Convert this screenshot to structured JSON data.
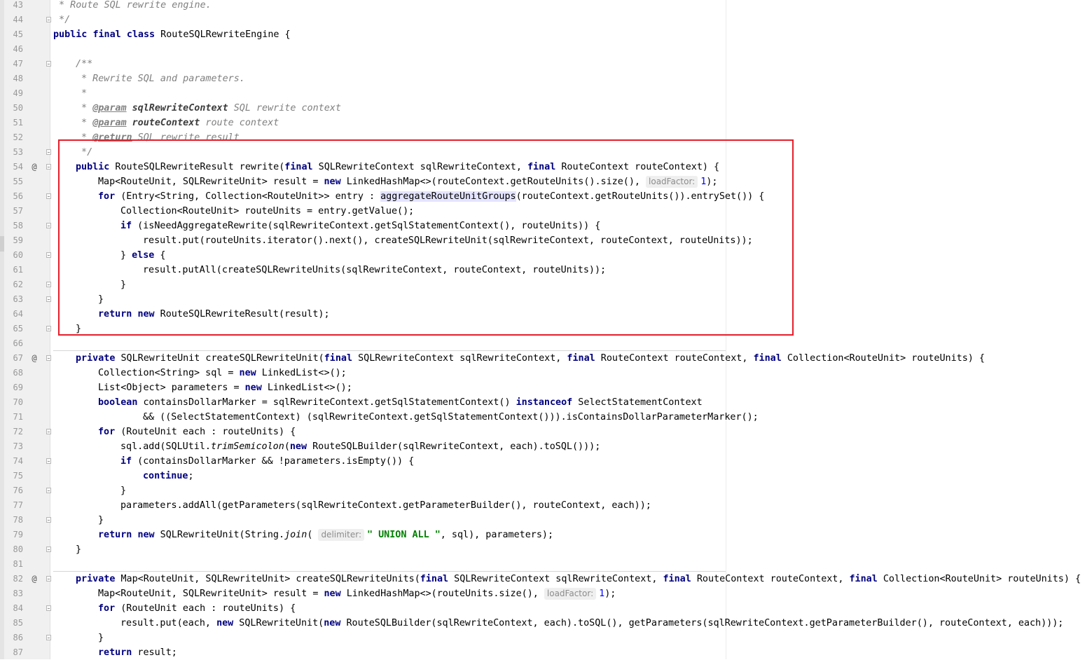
{
  "editor": {
    "lines": [
      {
        "num": "43",
        "marker": "",
        "fold": false,
        "indent": 0,
        "tokens": [
          {
            "t": " * Route SQL rewrite engine.",
            "c": "cm"
          }
        ]
      },
      {
        "num": "44",
        "marker": "",
        "fold": true,
        "indent": 0,
        "tokens": [
          {
            "t": " */",
            "c": "cm"
          }
        ]
      },
      {
        "num": "45",
        "marker": "",
        "fold": false,
        "indent": 0,
        "tokens": [
          {
            "t": "public",
            "c": "kw"
          },
          {
            "t": " "
          },
          {
            "t": "final",
            "c": "kw"
          },
          {
            "t": " "
          },
          {
            "t": "class",
            "c": "kw"
          },
          {
            "t": " RouteSQLRewriteEngine {"
          }
        ]
      },
      {
        "num": "46",
        "marker": "",
        "fold": false,
        "indent": 0,
        "tokens": []
      },
      {
        "num": "47",
        "marker": "",
        "fold": true,
        "indent": 1,
        "tokens": [
          {
            "t": "/**",
            "c": "cm"
          }
        ]
      },
      {
        "num": "48",
        "marker": "",
        "fold": false,
        "indent": 1,
        "tokens": [
          {
            "t": " * Rewrite SQL and parameters.",
            "c": "cm"
          }
        ]
      },
      {
        "num": "49",
        "marker": "",
        "fold": false,
        "indent": 1,
        "tokens": [
          {
            "t": " *",
            "c": "cm"
          }
        ]
      },
      {
        "num": "50",
        "marker": "",
        "fold": false,
        "indent": 1,
        "tokens": [
          {
            "t": " * ",
            "c": "cm"
          },
          {
            "t": "@param",
            "c": "tag"
          },
          {
            "t": " "
          },
          {
            "t": "sqlRewriteContext",
            "c": "tagp"
          },
          {
            "t": " SQL rewrite context",
            "c": "cm"
          }
        ]
      },
      {
        "num": "51",
        "marker": "",
        "fold": false,
        "indent": 1,
        "tokens": [
          {
            "t": " * ",
            "c": "cm"
          },
          {
            "t": "@param",
            "c": "tag"
          },
          {
            "t": " "
          },
          {
            "t": "routeContext",
            "c": "tagp"
          },
          {
            "t": " route context",
            "c": "cm"
          }
        ]
      },
      {
        "num": "52",
        "marker": "",
        "fold": false,
        "indent": 1,
        "tokens": [
          {
            "t": " * ",
            "c": "cm"
          },
          {
            "t": "@return",
            "c": "tag"
          },
          {
            "t": " SQL rewrite result",
            "c": "cm"
          }
        ]
      },
      {
        "num": "53",
        "marker": "",
        "fold": true,
        "indent": 1,
        "tokens": [
          {
            "t": " */",
            "c": "cm"
          }
        ]
      },
      {
        "num": "54",
        "marker": "@",
        "fold": true,
        "indent": 1,
        "tokens": [
          {
            "t": "public",
            "c": "kw"
          },
          {
            "t": " RouteSQLRewriteResult rewrite("
          },
          {
            "t": "final",
            "c": "kw"
          },
          {
            "t": " SQLRewriteContext sqlRewriteContext, "
          },
          {
            "t": "final",
            "c": "kw"
          },
          {
            "t": " RouteContext routeContext) {"
          }
        ]
      },
      {
        "num": "55",
        "marker": "",
        "fold": false,
        "indent": 2,
        "tokens": [
          {
            "t": "Map<RouteUnit, SQLRewriteUnit> result = "
          },
          {
            "t": "new",
            "c": "kw"
          },
          {
            "t": " LinkedHashMap<>(routeContext.getRouteUnits().size(), "
          },
          {
            "t": "loadFactor:",
            "c": "hint"
          },
          {
            "t": "1",
            "c": "num"
          },
          {
            "t": ");"
          }
        ]
      },
      {
        "num": "56",
        "marker": "",
        "fold": true,
        "indent": 2,
        "tokens": [
          {
            "t": "for",
            "c": "kw"
          },
          {
            "t": " (Entry<String, Collection<RouteUnit>> entry : "
          },
          {
            "t": "aggregateRouteUnitGroups",
            "c": "hl"
          },
          {
            "t": "(routeContext.getRouteUnits()).entrySet()) {"
          }
        ]
      },
      {
        "num": "57",
        "marker": "",
        "fold": false,
        "indent": 3,
        "tokens": [
          {
            "t": "Collection<RouteUnit> routeUnits = entry.getValue();"
          }
        ]
      },
      {
        "num": "58",
        "marker": "",
        "fold": true,
        "indent": 3,
        "tokens": [
          {
            "t": "if",
            "c": "kw"
          },
          {
            "t": " (isNeedAggregateRewrite(sqlRewriteContext.getSqlStatementContext(), routeUnits)) {"
          }
        ]
      },
      {
        "num": "59",
        "marker": "",
        "fold": false,
        "indent": 4,
        "tokens": [
          {
            "t": "result.put(routeUnits.iterator().next(), createSQLRewriteUnit(sqlRewriteContext, routeContext, routeUnits));"
          }
        ]
      },
      {
        "num": "60",
        "marker": "",
        "fold": true,
        "indent": 3,
        "tokens": [
          {
            "t": "} "
          },
          {
            "t": "else",
            "c": "kw"
          },
          {
            "t": " {"
          }
        ]
      },
      {
        "num": "61",
        "marker": "",
        "fold": false,
        "indent": 4,
        "tokens": [
          {
            "t": "result.putAll(createSQLRewriteUnits(sqlRewriteContext, routeContext, routeUnits));"
          }
        ]
      },
      {
        "num": "62",
        "marker": "",
        "fold": true,
        "indent": 3,
        "tokens": [
          {
            "t": "}"
          }
        ]
      },
      {
        "num": "63",
        "marker": "",
        "fold": true,
        "indent": 2,
        "tokens": [
          {
            "t": "}"
          }
        ]
      },
      {
        "num": "64",
        "marker": "",
        "fold": false,
        "indent": 2,
        "tokens": [
          {
            "t": "return",
            "c": "kw"
          },
          {
            "t": " "
          },
          {
            "t": "new",
            "c": "kw"
          },
          {
            "t": " RouteSQLRewriteResult(result);"
          }
        ]
      },
      {
        "num": "65",
        "marker": "",
        "fold": true,
        "indent": 1,
        "tokens": [
          {
            "t": "}"
          }
        ]
      },
      {
        "num": "66",
        "marker": "",
        "fold": false,
        "indent": 0,
        "tokens": []
      },
      {
        "num": "67",
        "marker": "@",
        "fold": true,
        "indent": 1,
        "tokens": [
          {
            "t": "private",
            "c": "kw"
          },
          {
            "t": " SQLRewriteUnit createSQLRewriteUnit("
          },
          {
            "t": "final",
            "c": "kw"
          },
          {
            "t": " SQLRewriteContext sqlRewriteContext, "
          },
          {
            "t": "final",
            "c": "kw"
          },
          {
            "t": " RouteContext routeContext, "
          },
          {
            "t": "final",
            "c": "kw"
          },
          {
            "t": " Collection<RouteUnit> routeUnits) {"
          }
        ]
      },
      {
        "num": "68",
        "marker": "",
        "fold": false,
        "indent": 2,
        "tokens": [
          {
            "t": "Collection<String> sql = "
          },
          {
            "t": "new",
            "c": "kw"
          },
          {
            "t": " LinkedList<>();"
          }
        ]
      },
      {
        "num": "69",
        "marker": "",
        "fold": false,
        "indent": 2,
        "tokens": [
          {
            "t": "List<Object> parameters = "
          },
          {
            "t": "new",
            "c": "kw"
          },
          {
            "t": " LinkedList<>();"
          }
        ]
      },
      {
        "num": "70",
        "marker": "",
        "fold": false,
        "indent": 2,
        "tokens": [
          {
            "t": "boolean",
            "c": "kw"
          },
          {
            "t": " containsDollarMarker = sqlRewriteContext.getSqlStatementContext() "
          },
          {
            "t": "instanceof",
            "c": "kw"
          },
          {
            "t": " SelectStatementContext"
          }
        ]
      },
      {
        "num": "71",
        "marker": "",
        "fold": false,
        "indent": 4,
        "tokens": [
          {
            "t": "&& ((SelectStatementContext) (sqlRewriteContext.getSqlStatementContext())).isContainsDollarParameterMarker();"
          }
        ]
      },
      {
        "num": "72",
        "marker": "",
        "fold": true,
        "indent": 2,
        "tokens": [
          {
            "t": "for",
            "c": "kw"
          },
          {
            "t": " (RouteUnit each : routeUnits) {"
          }
        ]
      },
      {
        "num": "73",
        "marker": "",
        "fold": false,
        "indent": 3,
        "tokens": [
          {
            "t": "sql.add(SQLUtil."
          },
          {
            "t": "trimSemicolon",
            "c": "st"
          },
          {
            "t": "("
          },
          {
            "t": "new",
            "c": "kw"
          },
          {
            "t": " RouteSQLBuilder(sqlRewriteContext, each).toSQL()));"
          }
        ]
      },
      {
        "num": "74",
        "marker": "",
        "fold": true,
        "indent": 3,
        "tokens": [
          {
            "t": "if",
            "c": "kw"
          },
          {
            "t": " (containsDollarMarker && !parameters.isEmpty()) {"
          }
        ]
      },
      {
        "num": "75",
        "marker": "",
        "fold": false,
        "indent": 4,
        "tokens": [
          {
            "t": "continue",
            "c": "kw"
          },
          {
            "t": ";"
          }
        ]
      },
      {
        "num": "76",
        "marker": "",
        "fold": true,
        "indent": 3,
        "tokens": [
          {
            "t": "}"
          }
        ]
      },
      {
        "num": "77",
        "marker": "",
        "fold": false,
        "indent": 3,
        "tokens": [
          {
            "t": "parameters.addAll(getParameters(sqlRewriteContext.getParameterBuilder(), routeContext, each));"
          }
        ]
      },
      {
        "num": "78",
        "marker": "",
        "fold": true,
        "indent": 2,
        "tokens": [
          {
            "t": "}"
          }
        ]
      },
      {
        "num": "79",
        "marker": "",
        "fold": false,
        "indent": 2,
        "tokens": [
          {
            "t": "return",
            "c": "kw"
          },
          {
            "t": " "
          },
          {
            "t": "new",
            "c": "kw"
          },
          {
            "t": " SQLRewriteUnit(String."
          },
          {
            "t": "join",
            "c": "st"
          },
          {
            "t": "( "
          },
          {
            "t": "delimiter:",
            "c": "hint"
          },
          {
            "t": "\" UNION ALL \"",
            "c": "str"
          },
          {
            "t": ", sql), parameters);"
          }
        ]
      },
      {
        "num": "80",
        "marker": "",
        "fold": true,
        "indent": 1,
        "tokens": [
          {
            "t": "}"
          }
        ]
      },
      {
        "num": "81",
        "marker": "",
        "fold": false,
        "indent": 0,
        "tokens": []
      },
      {
        "num": "82",
        "marker": "@",
        "fold": true,
        "indent": 1,
        "tokens": [
          {
            "t": "private",
            "c": "kw"
          },
          {
            "t": " Map<RouteUnit, SQLRewriteUnit> createSQLRewriteUnits("
          },
          {
            "t": "final",
            "c": "kw"
          },
          {
            "t": " SQLRewriteContext sqlRewriteContext, "
          },
          {
            "t": "final",
            "c": "kw"
          },
          {
            "t": " RouteContext routeContext, "
          },
          {
            "t": "final",
            "c": "kw"
          },
          {
            "t": " Collection<RouteUnit> routeUnits) {"
          }
        ]
      },
      {
        "num": "83",
        "marker": "",
        "fold": false,
        "indent": 2,
        "tokens": [
          {
            "t": "Map<RouteUnit, SQLRewriteUnit> result = "
          },
          {
            "t": "new",
            "c": "kw"
          },
          {
            "t": " LinkedHashMap<>(routeUnits.size(), "
          },
          {
            "t": "loadFactor:",
            "c": "hint"
          },
          {
            "t": "1",
            "c": "num"
          },
          {
            "t": ");"
          }
        ]
      },
      {
        "num": "84",
        "marker": "",
        "fold": true,
        "indent": 2,
        "tokens": [
          {
            "t": "for",
            "c": "kw"
          },
          {
            "t": " (RouteUnit each : routeUnits) {"
          }
        ]
      },
      {
        "num": "85",
        "marker": "",
        "fold": false,
        "indent": 3,
        "tokens": [
          {
            "t": "result.put(each, "
          },
          {
            "t": "new",
            "c": "kw"
          },
          {
            "t": " SQLRewriteUnit("
          },
          {
            "t": "new",
            "c": "kw"
          },
          {
            "t": " RouteSQLBuilder(sqlRewriteContext, each).toSQL(), getParameters(sqlRewriteContext.getParameterBuilder(), routeContext, each)));"
          }
        ]
      },
      {
        "num": "86",
        "marker": "",
        "fold": true,
        "indent": 2,
        "tokens": [
          {
            "t": "}"
          }
        ]
      },
      {
        "num": "87",
        "marker": "",
        "fold": false,
        "indent": 2,
        "tokens": [
          {
            "t": "return",
            "c": "kw"
          },
          {
            "t": " result;"
          }
        ]
      }
    ]
  },
  "colors": {
    "keyword": "#000080",
    "comment": "#808080",
    "string": "#008000",
    "number": "#0000ff",
    "highlight_box": "#e61e2a"
  }
}
